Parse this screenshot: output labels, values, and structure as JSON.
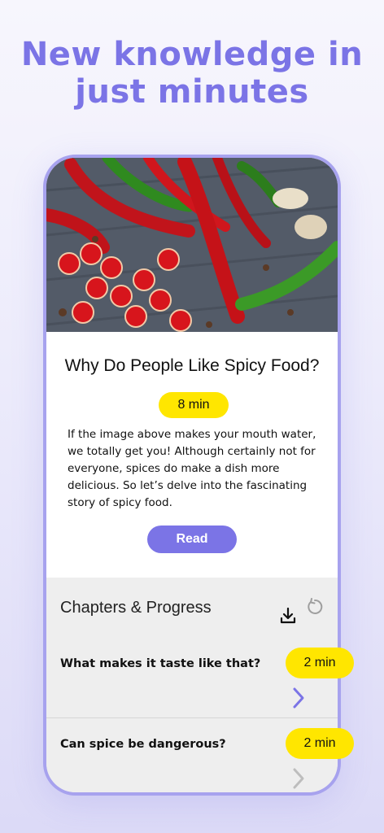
{
  "headline": {
    "line1": "New knowledge in",
    "line2": "just minutes"
  },
  "article": {
    "title": "Why Do People Like Spicy Food?",
    "duration": "8 min",
    "description": "If the image above makes your mouth water, we totally get you! Although certainly not for everyone, spices do make a dish more delicious. So let’s delve into the fascinating story of spicy food.",
    "read_label": "Read"
  },
  "chapters": {
    "title": "Chapters & Progress",
    "download_icon": "download-icon",
    "reset_icon": "reset-icon",
    "items": [
      {
        "label": "What makes it taste like that?",
        "duration": "2 min",
        "chevron_color": "#7b74e6"
      },
      {
        "label": "Can spice be dangerous?",
        "duration": "2 min",
        "chevron_color": "#bdbdbd"
      }
    ]
  },
  "colors": {
    "accent": "#7b74e6",
    "badge": "#ffe600"
  }
}
